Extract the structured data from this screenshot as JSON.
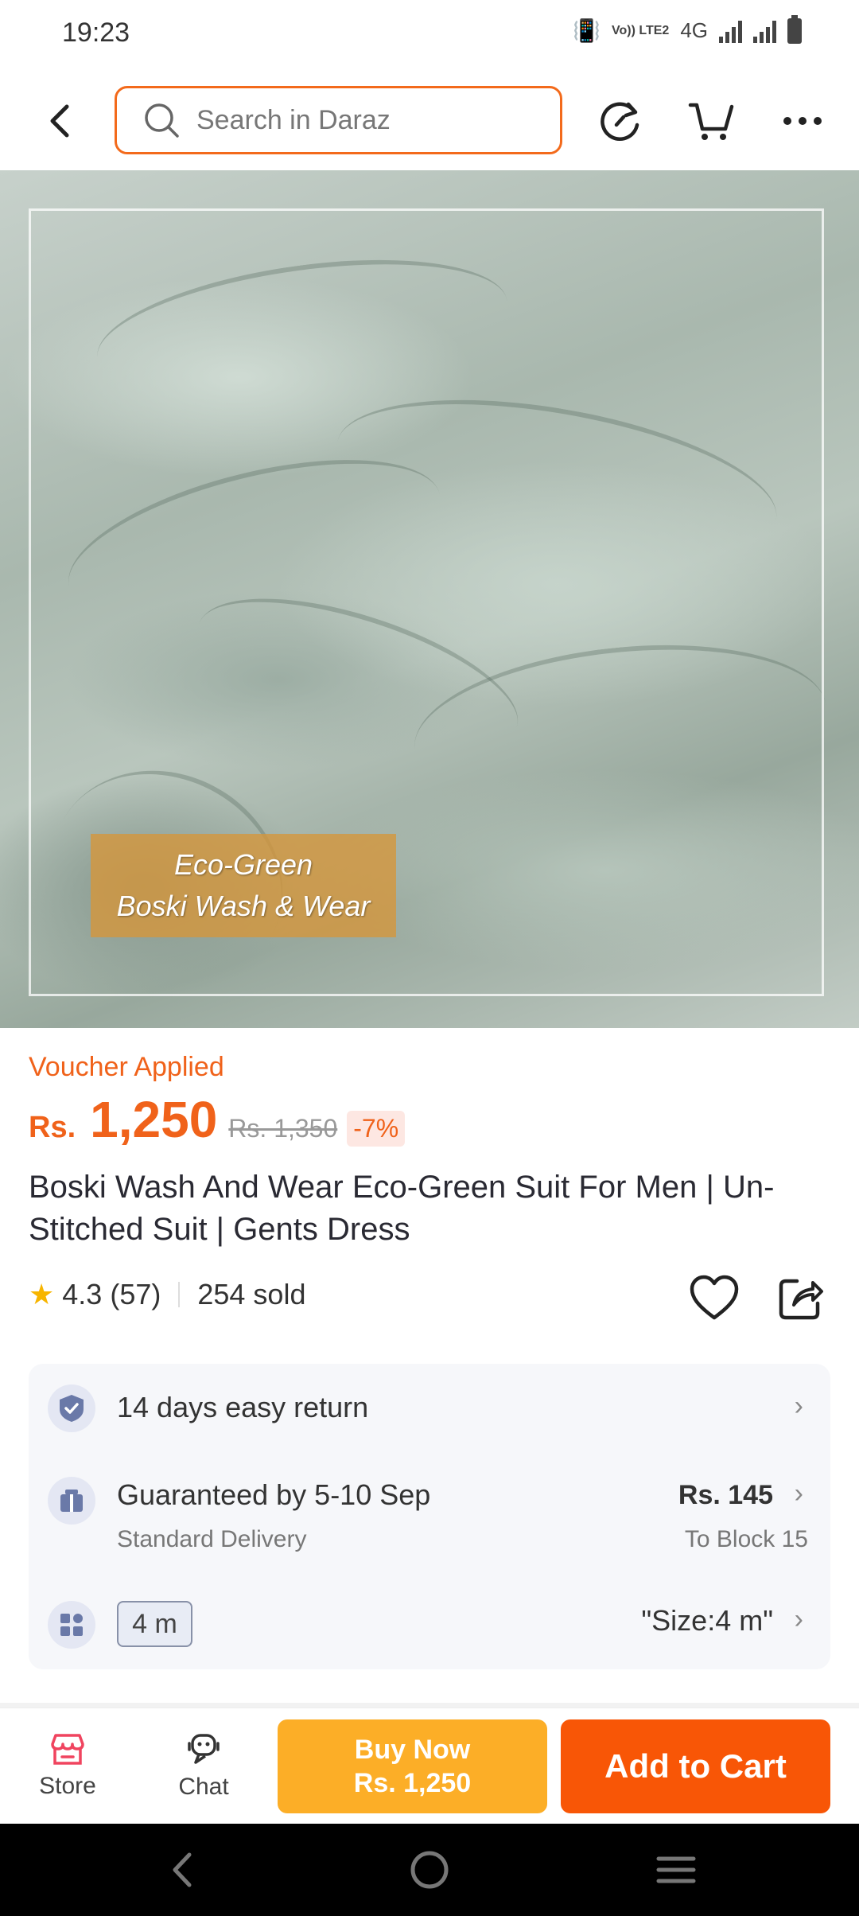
{
  "status_bar": {
    "time": "19:23",
    "volte": "Vo)) LTE2",
    "network": "4G"
  },
  "header": {
    "search_placeholder": "Search in Daraz"
  },
  "hero": {
    "tag_line1": "Eco-Green",
    "tag_line2": "Boski Wash & Wear"
  },
  "product": {
    "voucher": "Voucher Applied",
    "currency": "Rs.",
    "price": "1,250",
    "old_price": "Rs. 1,350",
    "discount": "-7%",
    "title": "Boski Wash And Wear Eco-Green Suit For Men | Un-Stitched Suit | Gents Dress",
    "rating": "4.3 (57)",
    "sold": "254 sold"
  },
  "info": {
    "return_label": "14 days easy return",
    "delivery_label": "Guaranteed by 5-10 Sep",
    "delivery_sub": "Standard Delivery",
    "delivery_fee": "Rs. 145",
    "delivery_dest": "To Block 15",
    "size_chip": "4 m",
    "size_value": "\"Size:4 m\""
  },
  "bottom_bar": {
    "store_label": "Store",
    "chat_label": "Chat",
    "buy_now_line1": "Buy Now",
    "buy_now_line2": "Rs. 1,250",
    "add_to_cart": "Add to Cart"
  },
  "colors": {
    "brand_orange": "#f85606",
    "buy_now_yellow": "#fcae27",
    "price_orange": "#f0621a"
  }
}
